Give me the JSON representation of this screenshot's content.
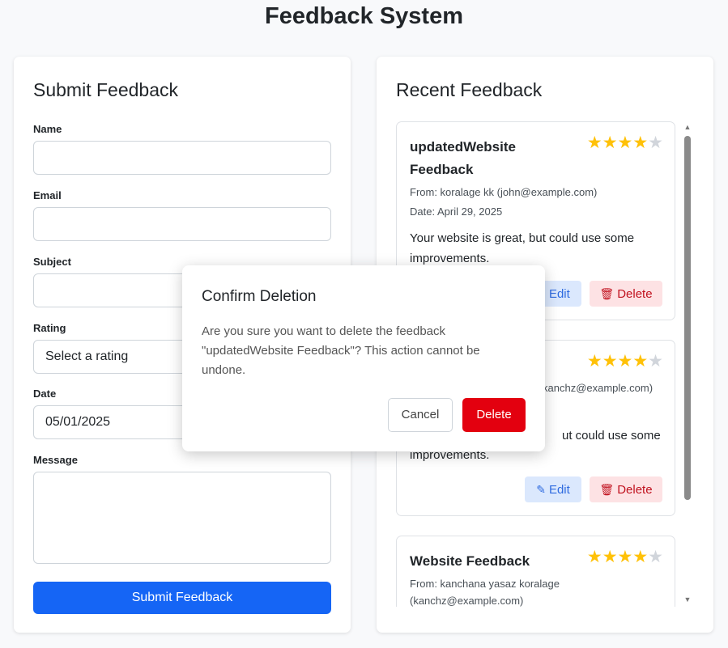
{
  "app": {
    "title": "Feedback System"
  },
  "form": {
    "title": "Submit Feedback",
    "name_label": "Name",
    "name_value": "",
    "email_label": "Email",
    "email_value": "",
    "subject_label": "Subject",
    "subject_value": "",
    "rating_label": "Rating",
    "rating_value": "Select a rating",
    "date_label": "Date",
    "date_value": "05/01/2025",
    "message_label": "Message",
    "message_value": "",
    "submit_label": "Submit Feedback"
  },
  "list": {
    "title": "Recent Feedback",
    "edit_label": "Edit",
    "delete_label": "Delete",
    "items": [
      {
        "title_line1": "updatedWebsite",
        "title_line2": "Feedback",
        "from": "From: koralage kk (john@example.com)",
        "date": "Date: April 29, 2025",
        "msg_line1": "Your website is great, but could use some",
        "msg_line2": "improvements.",
        "rating": 4
      },
      {
        "from_visible": "kanchz@example.com)",
        "msg_line1_visible": "ut could use some",
        "msg_line2": "improvements.",
        "rating": 4
      },
      {
        "title": "Website Feedback",
        "from_line1": "From: kanchana yasaz koralage",
        "from_line2": "(kanchz@example.com)",
        "rating": 4
      }
    ]
  },
  "modal": {
    "title": "Confirm Deletion",
    "body": "Are you sure you want to delete the feedback \"updatedWebsite Feedback\"? This action cannot be undone.",
    "cancel_label": "Cancel",
    "confirm_label": "Delete"
  },
  "colors": {
    "primary": "#1565f5",
    "danger": "#e3000f",
    "star": "#ffc107"
  }
}
